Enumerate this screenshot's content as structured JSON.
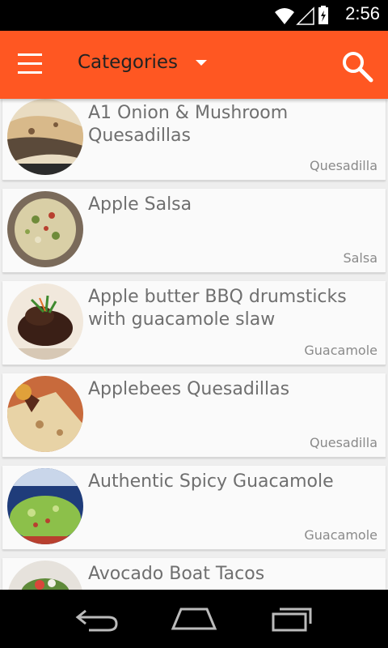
{
  "status_bar": {
    "time": "2:56"
  },
  "app_bar": {
    "category_label": "Categories"
  },
  "recipes": [
    {
      "title": "A1 Onion & Mushroom Quesadillas",
      "category": "Quesadilla"
    },
    {
      "title": "Apple Salsa",
      "category": "Salsa"
    },
    {
      "title": "Apple butter BBQ drumsticks with guacamole slaw",
      "category": "Guacamole"
    },
    {
      "title": "Applebees Quesadillas",
      "category": "Quesadilla"
    },
    {
      "title": "Authentic Spicy Guacamole",
      "category": "Guacamole"
    },
    {
      "title": "Avocado Boat Tacos",
      "category": ""
    }
  ],
  "colors": {
    "accent": "#ff5722",
    "status_bar": "#000000",
    "nav_bar": "#000000",
    "card": "#fafafa"
  }
}
